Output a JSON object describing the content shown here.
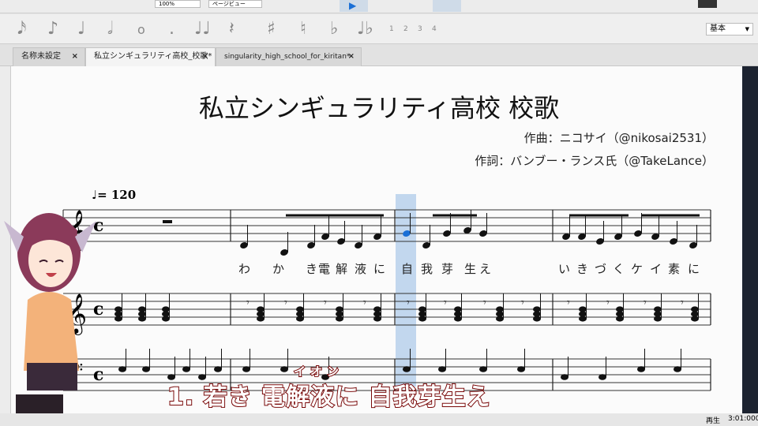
{
  "toolbar": {
    "zoom": "100%",
    "view": "ページビュー",
    "palette_select": "基本",
    "voices": [
      "1",
      "2",
      "3",
      "4"
    ]
  },
  "tabs": [
    {
      "label": "名称未設定"
    },
    {
      "label": "私立シンギュラリティ高校_校歌*"
    },
    {
      "label": "singularity_high_school_for_kiritan*"
    }
  ],
  "tab_close": "×",
  "score": {
    "title": "私立シンギュラリティ高校 校歌",
    "composer": "作曲：ニコサイ（@nikosai2531）",
    "lyricist": "作詞：バンブー・ランス氏（@TakeLance）",
    "tempo": "♩= 120",
    "lyrics": [
      "わ",
      "か",
      "き",
      "電",
      "解",
      "液",
      "に",
      "自",
      "我",
      "芽",
      "生",
      "え",
      "い",
      "き",
      "づ",
      "く",
      "ケ",
      "イ",
      "素",
      "に"
    ]
  },
  "overlay": {
    "subtitle": "1. 若き 電解液に 自我芽生え",
    "ruby": "イオン"
  },
  "status": {
    "mode": "再生",
    "time": "3:01:000"
  },
  "colors": {
    "playhead": "#a9c8e8",
    "selected_note": "#1a6fd6",
    "subtitle_outline": "#7a0a0a"
  }
}
